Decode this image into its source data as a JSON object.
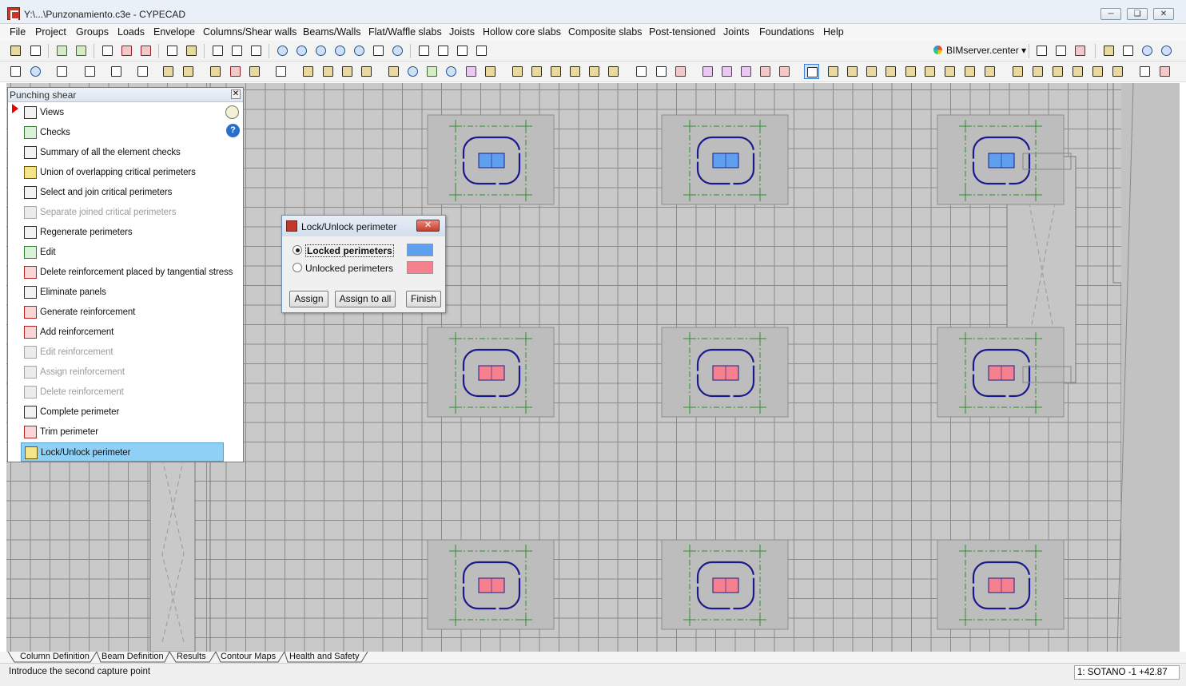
{
  "window": {
    "title": "Y:\\...\\Punzonamiento.c3e - CYPECAD",
    "controls": [
      "minimize",
      "restore",
      "close"
    ]
  },
  "menu": [
    {
      "label": "File"
    },
    {
      "label": "Project"
    },
    {
      "label": "Groups"
    },
    {
      "label": "Loads"
    },
    {
      "label": "Envelope"
    },
    {
      "label": "Columns/Shear walls"
    },
    {
      "label": "Beams/Walls"
    },
    {
      "label": "Flat/Waffle slabs"
    },
    {
      "label": "Joists"
    },
    {
      "label": "Hollow core slabs"
    },
    {
      "label": "Composite slabs"
    },
    {
      "label": "Post-tensioned"
    },
    {
      "label": "Joints"
    },
    {
      "label": "Foundations"
    },
    {
      "label": "Help"
    }
  ],
  "toolbar": {
    "bimserver_label": "BIMserver.center",
    "dropdown_icon": "chevron-down-icon"
  },
  "panel": {
    "title": "Punching shear",
    "items": [
      {
        "label": "Views",
        "icon": "views-icon",
        "enabled": true
      },
      {
        "label": "Checks",
        "icon": "checks-icon",
        "enabled": true
      },
      {
        "label": "Summary of all the element checks",
        "icon": "summary-icon",
        "enabled": true
      },
      {
        "label": "Union of overlapping critical perimeters",
        "icon": "union-perimeters-icon",
        "enabled": true
      },
      {
        "label": "Select and join critical perimeters",
        "icon": "join-perimeters-icon",
        "enabled": true
      },
      {
        "label": "Separate joined critical perimeters",
        "icon": "separate-perimeters-icon",
        "enabled": false
      },
      {
        "label": "Regenerate perimeters",
        "icon": "regenerate-icon",
        "enabled": true
      },
      {
        "label": "Edit",
        "icon": "edit-icon",
        "enabled": true
      },
      {
        "label": "Delete reinforcement placed by tangential stress",
        "icon": "delete-tangential-icon",
        "enabled": true
      },
      {
        "label": "Eliminate panels",
        "icon": "eliminate-panels-icon",
        "enabled": true
      },
      {
        "label": "Generate reinforcement",
        "icon": "generate-reinforcement-icon",
        "enabled": true
      },
      {
        "label": "Add reinforcement",
        "icon": "add-reinforcement-icon",
        "enabled": true
      },
      {
        "label": "Edit reinforcement",
        "icon": "edit-reinforcement-icon",
        "enabled": false
      },
      {
        "label": "Assign reinforcement",
        "icon": "assign-reinforcement-icon",
        "enabled": false
      },
      {
        "label": "Delete reinforcement",
        "icon": "delete-reinforcement-icon",
        "enabled": false
      },
      {
        "label": "Complete perimeter",
        "icon": "complete-perimeter-icon",
        "enabled": true
      },
      {
        "label": "Trim perimeter",
        "icon": "trim-perimeter-icon",
        "enabled": true
      },
      {
        "label": "Lock/Unlock perimeter",
        "icon": "lock-perimeter-icon",
        "enabled": true,
        "active": true
      }
    ]
  },
  "dialog": {
    "title": "Lock/Unlock perimeter",
    "close": "✕",
    "options": [
      {
        "label": "Locked perimeters",
        "selected": true,
        "color": "#5ea0ee"
      },
      {
        "label": "Unlocked perimeters",
        "selected": false,
        "color": "#f5818f"
      }
    ],
    "buttons": {
      "assign": "Assign",
      "assign_all": "Assign to all",
      "finish": "Finish"
    }
  },
  "drawing": {
    "colors": {
      "locked": "#5ea0ee",
      "unlocked": "#f5818f",
      "perimeter": "#1a1a8c",
      "reinforcement": "#2f8f2f",
      "slab": "#c9c9c9",
      "panel": "#bdbdbd"
    },
    "columns": [
      {
        "row": 1,
        "col": 1,
        "state": "locked"
      },
      {
        "row": 1,
        "col": 2,
        "state": "locked"
      },
      {
        "row": 1,
        "col": 3,
        "state": "locked"
      },
      {
        "row": 2,
        "col": 1,
        "state": "unlocked"
      },
      {
        "row": 2,
        "col": 2,
        "state": "unlocked"
      },
      {
        "row": 2,
        "col": 3,
        "state": "unlocked"
      },
      {
        "row": 3,
        "col": 1,
        "state": "unlocked"
      },
      {
        "row": 3,
        "col": 2,
        "state": "unlocked"
      },
      {
        "row": 3,
        "col": 3,
        "state": "unlocked"
      }
    ]
  },
  "tabs": [
    {
      "label": "Column Definition"
    },
    {
      "label": "Beam Definition"
    },
    {
      "label": "Results",
      "active": true
    },
    {
      "label": "Contour Maps"
    },
    {
      "label": "Health and Safety"
    }
  ],
  "status": {
    "message": "Introduce the second capture point",
    "level": "1: SOTANO -1 +42.87"
  }
}
